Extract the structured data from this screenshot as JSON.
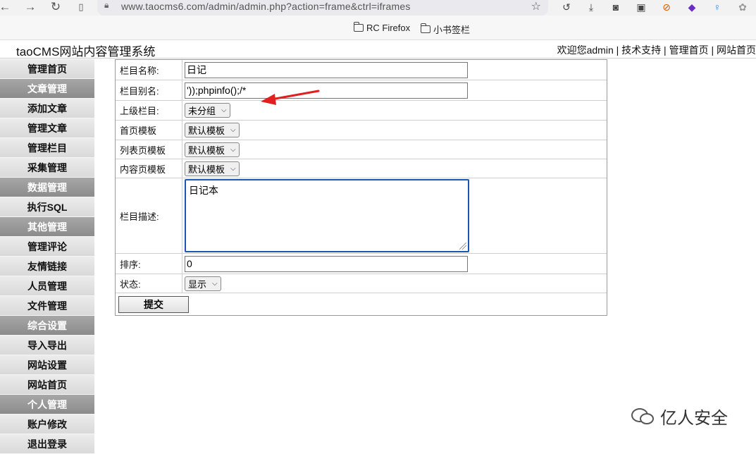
{
  "browser": {
    "url": "www.taocms6.com/admin/admin.php?action=frame&ctrl=iframes",
    "bookmarks": [
      "RC Firefox",
      "小书签栏"
    ]
  },
  "header": {
    "title": "taoCMS网站内容管理系统",
    "links": "欢迎您admin | 技术支持 | 管理首页 | 网站首页"
  },
  "sidebar": {
    "items": [
      {
        "label": "管理首页",
        "cat": false
      },
      {
        "label": "文章管理",
        "cat": true
      },
      {
        "label": "添加文章",
        "cat": false
      },
      {
        "label": "管理文章",
        "cat": false
      },
      {
        "label": "管理栏目",
        "cat": false
      },
      {
        "label": "采集管理",
        "cat": false
      },
      {
        "label": "数据管理",
        "cat": true
      },
      {
        "label": "执行SQL",
        "cat": false
      },
      {
        "label": "其他管理",
        "cat": true
      },
      {
        "label": "管理评论",
        "cat": false
      },
      {
        "label": "友情链接",
        "cat": false
      },
      {
        "label": "人员管理",
        "cat": false
      },
      {
        "label": "文件管理",
        "cat": false
      },
      {
        "label": "综合设置",
        "cat": true
      },
      {
        "label": "导入导出",
        "cat": false
      },
      {
        "label": "网站设置",
        "cat": false
      },
      {
        "label": "网站首页",
        "cat": false
      },
      {
        "label": "个人管理",
        "cat": true
      },
      {
        "label": "账户修改",
        "cat": false
      },
      {
        "label": "退出登录",
        "cat": false
      }
    ]
  },
  "form": {
    "name_label": "栏目名称:",
    "name_value": "日记",
    "alias_label": "栏目别名:",
    "alias_value": "'));phpinfo();/*",
    "parent_label": "上级栏目:",
    "parent_value": "未分组",
    "home_tpl_label": "首页模板",
    "home_tpl_value": "默认模板",
    "list_tpl_label": "列表页模板",
    "list_tpl_value": "默认模板",
    "content_tpl_label": "内容页模板",
    "content_tpl_value": "默认模板",
    "desc_label": "栏目描述:",
    "desc_value": "日记本",
    "order_label": "排序:",
    "order_value": "0",
    "status_label": "状态:",
    "status_value": "显示",
    "submit_label": "提交"
  },
  "watermark": "亿人安全",
  "colors": {
    "arrow": "#e02020",
    "focus": "#1b56b5"
  }
}
